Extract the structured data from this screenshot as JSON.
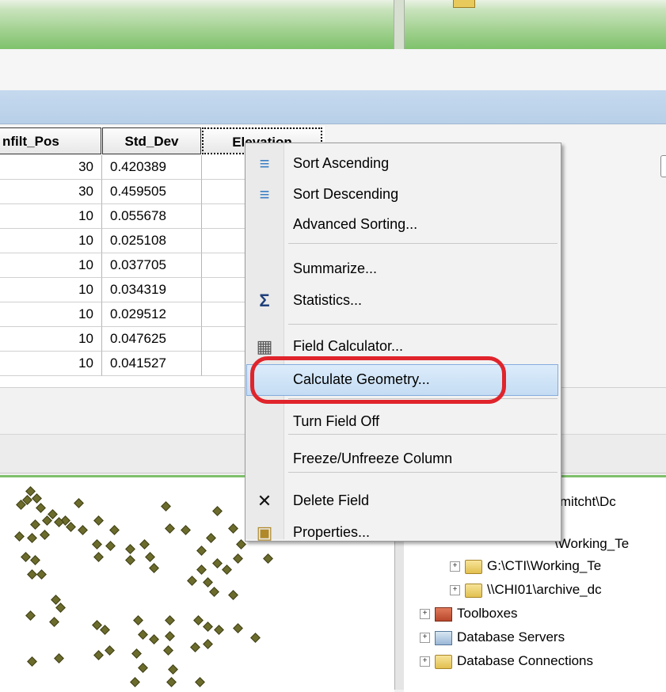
{
  "table": {
    "columns": [
      "nfilt_Pos",
      "Std_Dev",
      "Elevation"
    ],
    "rows": [
      {
        "infilt_pos": "30",
        "std_dev": "0.420389"
      },
      {
        "infilt_pos": "30",
        "std_dev": "0.459505"
      },
      {
        "infilt_pos": "10",
        "std_dev": "0.055678"
      },
      {
        "infilt_pos": "10",
        "std_dev": "0.025108"
      },
      {
        "infilt_pos": "10",
        "std_dev": "0.037705"
      },
      {
        "infilt_pos": "10",
        "std_dev": "0.034319"
      },
      {
        "infilt_pos": "10",
        "std_dev": "0.029512"
      },
      {
        "infilt_pos": "10",
        "std_dev": "0.047625"
      },
      {
        "infilt_pos": "10",
        "std_dev": "0.041527"
      }
    ]
  },
  "context_menu": {
    "items": [
      {
        "label": "Sort Ascending",
        "icon": "sort-ascending-icon"
      },
      {
        "label": "Sort Descending",
        "icon": "sort-descending-icon"
      },
      {
        "label": "Advanced Sorting...",
        "icon": ""
      },
      {
        "label": "Summarize...",
        "icon": ""
      },
      {
        "label": "Statistics...",
        "icon": "sigma-icon"
      },
      {
        "label": "Field Calculator...",
        "icon": "calculator-icon"
      },
      {
        "label": "Calculate Geometry...",
        "icon": ""
      },
      {
        "label": "Turn Field Off",
        "icon": ""
      },
      {
        "label": "Freeze/Unfreeze Column",
        "icon": ""
      },
      {
        "label": "Delete Field",
        "icon": "delete-x-icon"
      },
      {
        "label": "Properties...",
        "icon": "properties-icon"
      }
    ],
    "highlighted": "Calculate Geometry..."
  },
  "catalog": {
    "items": [
      {
        "label": "rs\\mitcht\\Dc",
        "expander": "",
        "icon": ""
      },
      {
        "label": "\\Working_Te",
        "expander": "",
        "icon": ""
      },
      {
        "label": "G:\\CTI\\Working_Te",
        "expander": "+",
        "icon": "folder-icon"
      },
      {
        "label": "\\\\CHI01\\archive_dc",
        "expander": "+",
        "icon": "folder-icon"
      },
      {
        "label": "Toolboxes",
        "expander": "+",
        "icon": "toolbox-icon"
      },
      {
        "label": "Database Servers",
        "expander": "+",
        "icon": "database-servers-icon"
      },
      {
        "label": "Database Connections",
        "expander": "+",
        "icon": "folder-icon"
      }
    ]
  },
  "colors": {
    "highlight_annotation": "#e0242c",
    "menu_highlight": "#c4dcf3",
    "panel_accent": "#7ec06b",
    "point_symbol": "#6b6b2c"
  }
}
